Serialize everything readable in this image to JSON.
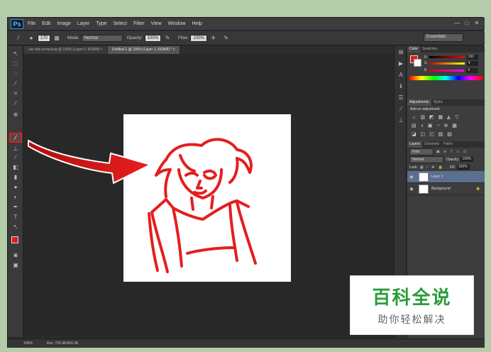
{
  "app": {
    "logo": "Ps"
  },
  "menu": [
    "File",
    "Edit",
    "Image",
    "Layer",
    "Type",
    "Select",
    "Filter",
    "View",
    "Window",
    "Help"
  ],
  "window_controls": [
    "—",
    "□",
    "✕"
  ],
  "options_bar": {
    "brush_size": "170",
    "mode_label": "Mode:",
    "mode_value": "Normal",
    "opacity_label": "Opacity:",
    "opacity_value": "100%",
    "flow_label": "Flow:",
    "flow_value": "100%",
    "workspace": "Essentials"
  },
  "tabs": [
    {
      "label": "use this arrow.png @ 100% (Layer 0, RGB/8) ×",
      "active": false
    },
    {
      "label": "Untitled-1 @ 100% (Layer 1, RGB/8) * ×",
      "active": true
    }
  ],
  "status": {
    "zoom": "100%",
    "doc": "Doc: 732.4K/626.3K"
  },
  "color_panel": {
    "tabs": [
      "Color",
      "Swatches"
    ],
    "channels": [
      {
        "label": "R",
        "value": "192"
      },
      {
        "label": "G",
        "value": "4"
      },
      {
        "label": "B",
        "value": "4"
      }
    ]
  },
  "adjustments_panel": {
    "tabs": [
      "Adjustments",
      "Styles"
    ],
    "heading": "Add an adjustment"
  },
  "layers_panel": {
    "tabs": [
      "Layers",
      "Channels",
      "Paths"
    ],
    "kind_label": "Kind",
    "blend_mode": "Normal",
    "opacity_label": "Opacity:",
    "opacity_value": "100%",
    "lock_label": "Lock:",
    "fill_label": "Fill:",
    "fill_value": "100%",
    "layers": [
      {
        "name": "Layer 1",
        "selected": true
      },
      {
        "name": "Background",
        "selected": false
      }
    ]
  },
  "watermark": {
    "title": "百科全说",
    "subtitle": "助你轻松解决"
  },
  "colors": {
    "accent_red": "#e01b1b",
    "layer_selected": "#5b6f8f"
  }
}
